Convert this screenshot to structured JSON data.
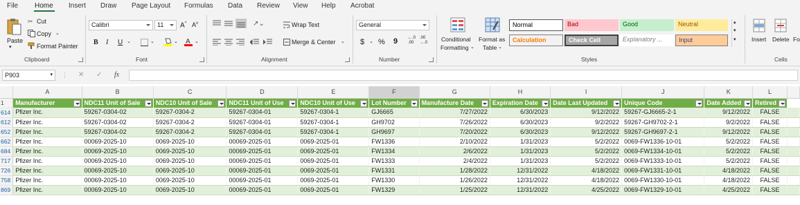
{
  "menu_tabs": [
    "File",
    "Home",
    "Insert",
    "Draw",
    "Page Layout",
    "Formulas",
    "Data",
    "Review",
    "View",
    "Help",
    "Acrobat"
  ],
  "ribbon": {
    "clipboard": {
      "paste": "Paste",
      "cut": "Cut",
      "copy": "Copy",
      "format_painter": "Format Painter",
      "label": "Clipboard"
    },
    "font": {
      "name": "Calibri",
      "size": "11",
      "label": "Font"
    },
    "alignment": {
      "wrap_text": "Wrap Text",
      "merge_center": "Merge & Center",
      "label": "Alignment"
    },
    "number": {
      "format": "General",
      "currency": "$",
      "percent": "%",
      "comma": "9",
      "label": "Number"
    },
    "styles_group": {
      "conditional_formatting": [
        "Conditional",
        "Formatting"
      ],
      "format_as_table": [
        "Format as",
        "Table"
      ],
      "label": "Styles",
      "normal": "Normal",
      "bad": "Bad",
      "good": "Good",
      "neutral": "Neutral",
      "calculation": "Calculation",
      "check_cell": "Check Cell",
      "explanatory": "Explanatory ...",
      "input": "Input"
    },
    "cells": {
      "insert": "Insert",
      "delete": "Delete",
      "format": "Fo",
      "label": "Cells"
    }
  },
  "formula_bar": {
    "name_box": "P903",
    "fx": "fx",
    "value": ""
  },
  "colors": {
    "table_header": "#70ad47",
    "band": "#e2efda",
    "ribbon_bg": "#f3f3f3",
    "accent": "#217346"
  },
  "columns": [
    "A",
    "B",
    "C",
    "D",
    "E",
    "F",
    "G",
    "H",
    "I",
    "J",
    "K",
    "L"
  ],
  "table": {
    "headers": [
      "Manufacturer",
      "NDC11 Unit of Sale",
      "NDC10 Unit of Sale",
      "NDC11 Unit of Use",
      "NDC10 Unit of Use",
      "Lot Number",
      "Manufacture Date",
      "Expiration Date",
      "Date Last Updated",
      "Unique Code",
      "Date Added",
      "Retired"
    ],
    "rows": [
      {
        "row": "614",
        "cells": [
          "Pfizer Inc.",
          "59267-0304-02",
          "59267-0304-2",
          "59267-0304-01",
          "59267-0304-1",
          "GJ6665",
          "7/27/2022",
          "6/30/2023",
          "9/12/2022",
          "59267-GJ6665-2-1",
          "9/12/2022",
          "FALSE"
        ]
      },
      {
        "row": "612",
        "cells": [
          "Pfizer Inc.",
          "59267-0304-02",
          "59267-0304-2",
          "59267-0304-01",
          "59267-0304-1",
          "GH9702",
          "7/26/2022",
          "6/30/2023",
          "9/2/2022",
          "59267-GH9702-2-1",
          "9/2/2022",
          "FALSE"
        ]
      },
      {
        "row": "652",
        "cells": [
          "Pfizer Inc.",
          "59267-0304-02",
          "59267-0304-2",
          "59267-0304-01",
          "59267-0304-1",
          "GH9697",
          "7/20/2022",
          "6/30/2023",
          "9/12/2022",
          "59267-GH9697-2-1",
          "9/12/2022",
          "FALSE"
        ]
      },
      {
        "row": "662",
        "cells": [
          "Pfizer Inc.",
          "00069-2025-10",
          "0069-2025-10",
          "00069-2025-01",
          "0069-2025-01",
          "FW1336",
          "2/10/2022",
          "1/31/2023",
          "5/2/2022",
          "0069-FW1336-10-01",
          "5/2/2022",
          "FALSE"
        ]
      },
      {
        "row": "684",
        "cells": [
          "Pfizer Inc.",
          "00069-2025-10",
          "0069-2025-10",
          "00069-2025-01",
          "0069-2025-01",
          "FW1334",
          "2/6/2022",
          "1/31/2023",
          "5/2/2022",
          "0069-FW1334-10-01",
          "5/2/2022",
          "FALSE"
        ]
      },
      {
        "row": "717",
        "cells": [
          "Pfizer Inc.",
          "00069-2025-10",
          "0069-2025-10",
          "00069-2025-01",
          "0069-2025-01",
          "FW1333",
          "2/4/2022",
          "1/31/2023",
          "5/2/2022",
          "0069-FW1333-10-01",
          "5/2/2022",
          "FALSE"
        ]
      },
      {
        "row": "726",
        "cells": [
          "Pfizer Inc.",
          "00069-2025-10",
          "0069-2025-10",
          "00069-2025-01",
          "0069-2025-01",
          "FW1331",
          "1/28/2022",
          "12/31/2022",
          "4/18/2022",
          "0069-FW1331-10-01",
          "4/18/2022",
          "FALSE"
        ]
      },
      {
        "row": "758",
        "cells": [
          "Pfizer Inc.",
          "00069-2025-10",
          "0069-2025-10",
          "00069-2025-01",
          "0069-2025-01",
          "FW1330",
          "1/26/2022",
          "12/31/2022",
          "4/18/2022",
          "0069-FW1330-10-01",
          "4/18/2022",
          "FALSE"
        ]
      },
      {
        "row": "869",
        "cells": [
          "Pfizer Inc.",
          "00069-2025-10",
          "0069-2025-10",
          "00069-2025-01",
          "0069-2025-01",
          "FW1329",
          "1/25/2022",
          "12/31/2022",
          "4/25/2022",
          "0069-FW1329-10-01",
          "4/25/2022",
          "FALSE"
        ]
      }
    ]
  }
}
